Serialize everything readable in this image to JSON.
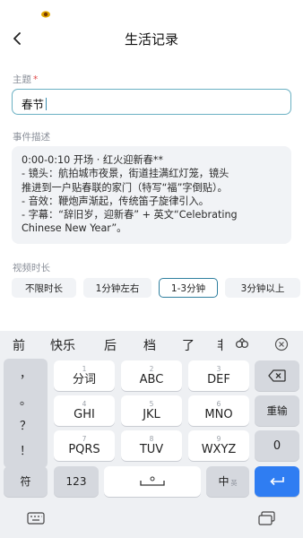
{
  "top_bar": {
    "title": "生活记录"
  },
  "form": {
    "subject_label": "主题",
    "subject_required": "*",
    "subject_value": "春节",
    "description_label": "事件描述",
    "description_lines": [
      "0:00-0:10 开场 · 红火迎新春**",
      "- 镜头：航拍城市夜景，街道挂满红灯笼，镜头",
      "推进到一户贴春联的家门（特写“福”字倒贴）。",
      "- 音效：鞭炮声渐起，传统笛子旋律引入。",
      "- 字幕：“辞旧岁，迎新春” + 英文“Celebrating",
      "Chinese New Year”。"
    ],
    "duration_label": "视频时长",
    "duration_options": [
      "不限时长",
      "1分钟左右",
      "1-3分钟",
      "3分钟以上"
    ],
    "duration_selected": "1-3分钟"
  },
  "keyboard": {
    "candidates": [
      "前",
      "快乐",
      "后",
      "档",
      "了",
      "非"
    ],
    "symbols": [
      "，",
      "。",
      "？",
      "！"
    ],
    "keys": {
      "r1": [
        {
          "num": "1",
          "main": "分词"
        },
        {
          "num": "2",
          "main": "ABC"
        },
        {
          "num": "3",
          "main": "DEF"
        }
      ],
      "r2": [
        {
          "num": "4",
          "main": "GHI"
        },
        {
          "num": "5",
          "main": "JKL"
        },
        {
          "num": "6",
          "main": "MNO"
        }
      ],
      "r3": [
        {
          "num": "7",
          "main": "PQRS"
        },
        {
          "num": "8",
          "main": "TUV"
        },
        {
          "num": "9",
          "main": "WXYZ"
        }
      ]
    },
    "reenter_label": "重输",
    "zero_label": "0",
    "fu_label": "符",
    "num_label": "123",
    "lang_label": "中",
    "lang_sub": "英"
  },
  "colors": {
    "accent": "#2f7f9f",
    "enter": "#2f7df2",
    "required": "#e04b4b"
  }
}
